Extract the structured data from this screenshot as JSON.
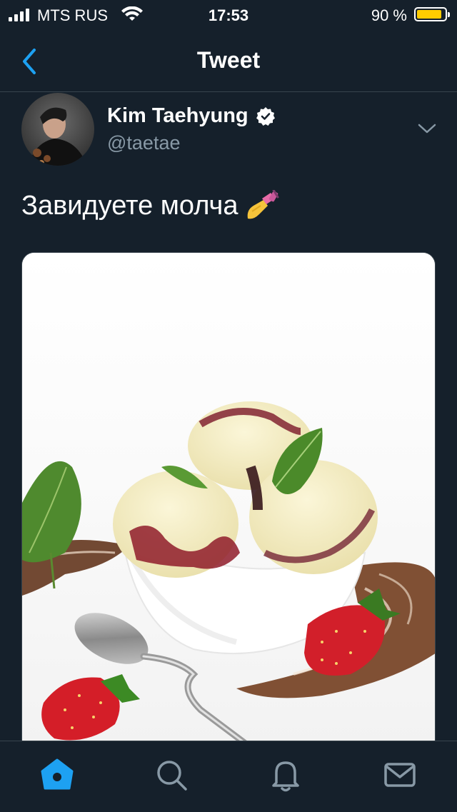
{
  "status_bar": {
    "carrier": "MTS RUS",
    "time": "17:53",
    "battery_percent": "90 %",
    "battery_level": 0.9,
    "battery_color": "#ffcc00"
  },
  "nav": {
    "title": "Tweet",
    "back_icon": "chevron-left-icon"
  },
  "tweet": {
    "author_name": "Kim Taehyung",
    "handle": "@taetae",
    "verified": true,
    "text": "Завидуете молча",
    "emoji": "nail-polish-emoji",
    "media": "photo of ice cream in a bowl with strawberries and a spoon"
  },
  "tab_bar": {
    "items": [
      "home-icon",
      "search-icon",
      "notifications-icon",
      "messages-icon"
    ],
    "active": "home-icon",
    "accent_color": "#1da1f2",
    "inactive_color": "#8899a6"
  }
}
